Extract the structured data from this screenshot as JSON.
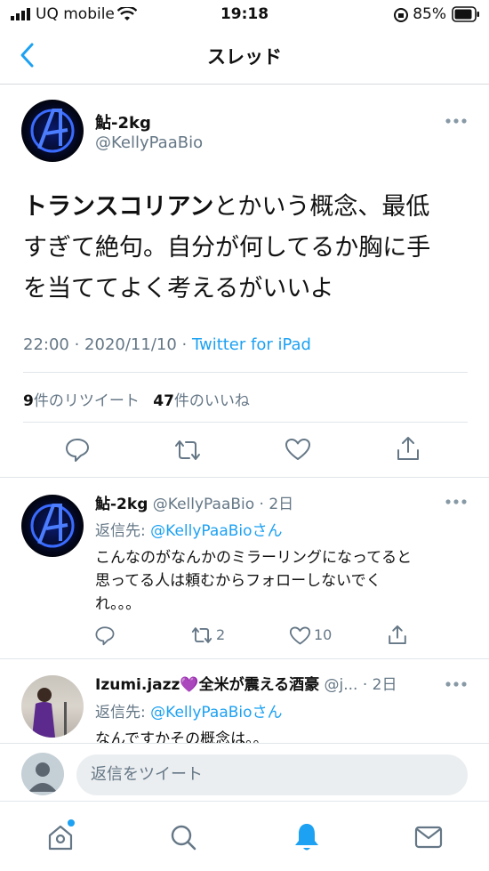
{
  "status": {
    "carrier": "UQ mobile",
    "time": "19:18",
    "battery": "85%"
  },
  "nav": {
    "title": "スレッド"
  },
  "main_tweet": {
    "name": "鮎-2kg",
    "handle": "@KellyPaaBio",
    "text_bold": "トランスコリアン",
    "text_line1_rest": "とかいう概念、最低",
    "text_line2": "すぎて絶句。自分が何してるか胸に手",
    "text_line3": "を当ててよく考えるがいいよ",
    "time": "22:00 · 2020/11/10 · ",
    "source": "Twitter for iPad",
    "retweet_count": "9",
    "retweet_label": "件のリツイート",
    "like_count": "47",
    "like_label": "件のいいね"
  },
  "reply1": {
    "name": "鮎-2kg",
    "meta": "@KellyPaaBio · 2日",
    "reply_to_label": "返信先: ",
    "reply_to_handle": "@KellyPaaBioさん",
    "line1": "こんなのがなんかのミラーリングになってると",
    "line2": "思ってる人は頼むからフォローしないでく",
    "line3": "れ。。。",
    "retweets": "2",
    "likes": "10"
  },
  "reply2": {
    "name": "Izumi.jazz💜全米が震える酒豪",
    "meta_handle": "@j...",
    "meta_time": "· 2日",
    "reply_to_label": "返信先: ",
    "reply_to_handle": "@KellyPaaBioさん",
    "line1": "なんですかその概念は。。"
  },
  "compose": {
    "placeholder": "返信をツイート"
  },
  "colors": {
    "accent": "#1da1f2",
    "muted": "#657786"
  }
}
